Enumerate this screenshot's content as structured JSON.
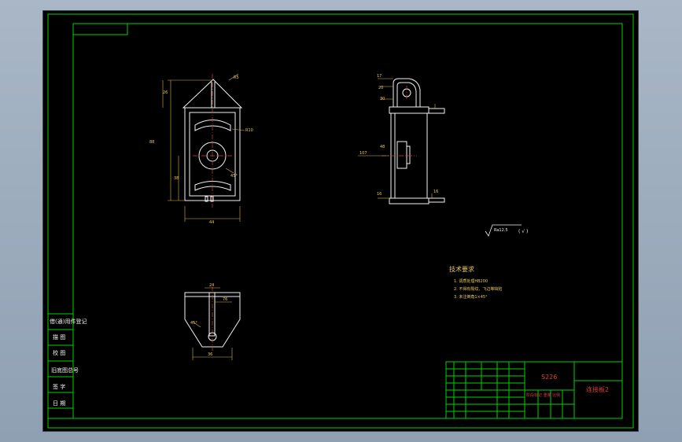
{
  "drawing": {
    "colors": {
      "frame": "#00d400",
      "geometry": "#f2f2f2",
      "dimension": "#d9b44a",
      "center": "#d04040",
      "text": "#e8c860",
      "background": "#000000"
    },
    "tech_requirements": {
      "title": "技术要求",
      "items": [
        "1. 调质处理HB200",
        "2. 不得有裂纹、飞边等缺陷",
        "3. 未注倒角1×45°"
      ]
    },
    "roughness": {
      "label": "Ra12.5",
      "suffix": "( √ )"
    },
    "side_labels": [
      "借(通)用件登记",
      "描 图",
      "校 图",
      "旧底图总号",
      "签 字",
      "日 期"
    ],
    "title_block": {
      "part_code": "S226",
      "part_name": "连接板2",
      "material_cell": "",
      "scale_row": "阶段标记  重量  比例"
    },
    "front_view_dims": {
      "height_total": "88",
      "height_top": "26",
      "width": "44",
      "angle": "R5",
      "radius_slot": "R10",
      "center_height": "38",
      "chamfer": "45°"
    },
    "side_view_dims": {
      "top_a": "17",
      "top_b": "20",
      "top_c": "30",
      "mid_a": "48",
      "mid_b": "107",
      "bottom_a": "16",
      "right_a": "16"
    },
    "top_view_dims": {
      "width_top": "24",
      "offset": "76",
      "angle": "45°",
      "width_bottom": "36"
    }
  }
}
